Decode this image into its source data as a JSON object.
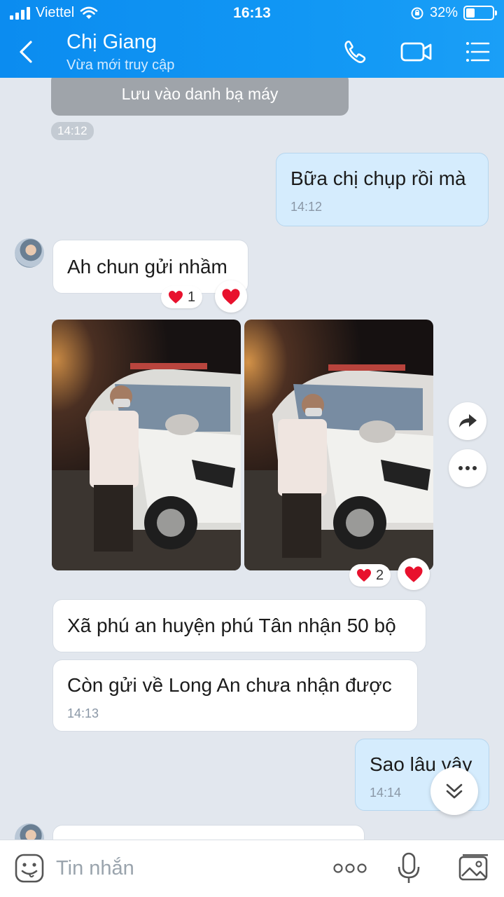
{
  "status_bar": {
    "carrier": "Viettel",
    "time": "16:13",
    "battery": "32%",
    "battery_level": 0.32
  },
  "header": {
    "contact_name": "Chị Giang",
    "contact_status": "Vừa mới truy cập"
  },
  "chat": {
    "system_action": "Lưu vào danh bạ máy",
    "system_time": "14:12",
    "messages": [
      {
        "direction": "out",
        "text": "Bữa chị chụp rồi mà",
        "time": "14:12"
      },
      {
        "direction": "in",
        "text": "Ah chun gửi nhầm",
        "reaction_count": "1"
      },
      {
        "direction": "in",
        "type": "photos",
        "reaction_count": "2"
      },
      {
        "direction": "in",
        "text": "Xã phú an huyện phú Tân nhận 50 bộ"
      },
      {
        "direction": "in",
        "text": "Còn gửi về Long An chưa nhận được",
        "time": "14:13"
      },
      {
        "direction": "out",
        "text": "Sao lâu vậy",
        "time": "14:14"
      }
    ]
  },
  "input": {
    "placeholder": "Tin nhắn"
  },
  "icons": {
    "back": "chevron-left-icon",
    "call": "phone-icon",
    "video": "video-camera-icon",
    "menu": "list-icon",
    "emoji": "emoji-icon",
    "more": "more-dots-icon",
    "mic": "microphone-icon",
    "image": "image-icon",
    "forward": "share-icon",
    "options": "ellipsis-icon",
    "heart": "heart-icon",
    "scroll": "double-chevron-down-icon"
  },
  "colors": {
    "header": "#0b8cf0",
    "bubble_out": "#d5ecfd",
    "bubble_in": "#ffffff",
    "background": "#e2e7ee",
    "heart": "#e8112d"
  }
}
